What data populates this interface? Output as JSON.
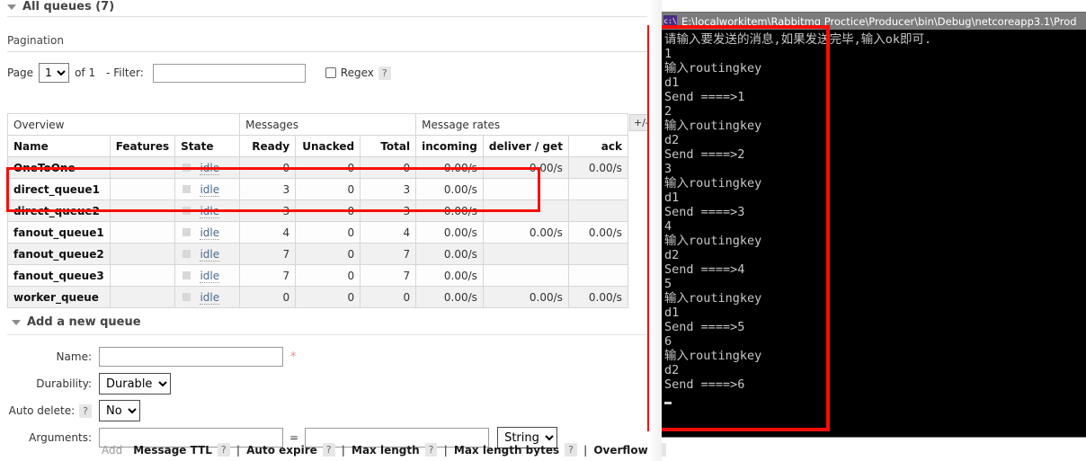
{
  "sections": {
    "all_queues_title": "All queues (7)",
    "pagination_title": "Pagination",
    "add_queue_title": "Add a new queue"
  },
  "pagination": {
    "page_label": "Page",
    "page_value": "1",
    "of_label": "of 1",
    "filter_label": "- Filter:",
    "filter_value": "",
    "regex_label": "Regex",
    "help_mark": "?"
  },
  "table": {
    "group_headers": [
      {
        "label": "Overview",
        "span": 3
      },
      {
        "label": "Messages",
        "span": 3
      },
      {
        "label": "Message rates",
        "span": 3
      }
    ],
    "columns": [
      "Name",
      "Features",
      "State",
      "Ready",
      "Unacked",
      "Total",
      "incoming",
      "deliver / get",
      "ack"
    ],
    "plus_minus": "+/-",
    "state_text": "idle",
    "rows": [
      {
        "name": "OneToOne",
        "features": "",
        "state": "idle",
        "ready": "0",
        "unacked": "0",
        "total": "0",
        "incoming": "0.00/s",
        "deliver": "0.00/s",
        "ack": "0.00/s"
      },
      {
        "name": "direct_queue1",
        "features": "",
        "state": "idle",
        "ready": "3",
        "unacked": "0",
        "total": "3",
        "incoming": "0.00/s",
        "deliver": "",
        "ack": ""
      },
      {
        "name": "direct_queue2",
        "features": "",
        "state": "idle",
        "ready": "3",
        "unacked": "0",
        "total": "3",
        "incoming": "0.00/s",
        "deliver": "",
        "ack": ""
      },
      {
        "name": "fanout_queue1",
        "features": "",
        "state": "idle",
        "ready": "4",
        "unacked": "0",
        "total": "4",
        "incoming": "0.00/s",
        "deliver": "0.00/s",
        "ack": "0.00/s"
      },
      {
        "name": "fanout_queue2",
        "features": "",
        "state": "idle",
        "ready": "7",
        "unacked": "0",
        "total": "7",
        "incoming": "0.00/s",
        "deliver": "",
        "ack": ""
      },
      {
        "name": "fanout_queue3",
        "features": "",
        "state": "idle",
        "ready": "7",
        "unacked": "0",
        "total": "7",
        "incoming": "0.00/s",
        "deliver": "",
        "ack": ""
      },
      {
        "name": "worker_queue",
        "features": "",
        "state": "idle",
        "ready": "0",
        "unacked": "0",
        "total": "0",
        "incoming": "0.00/s",
        "deliver": "0.00/s",
        "ack": "0.00/s"
      }
    ]
  },
  "form": {
    "name_label": "Name:",
    "name_value": "",
    "required_star": "*",
    "durability_label": "Durability:",
    "durability_value": "Durable",
    "auto_delete_label": "Auto delete:",
    "auto_delete_value": "No",
    "auto_delete_help": "?",
    "arguments_label": "Arguments:",
    "arg_key_value": "",
    "arg_eq": "=",
    "arg_val_value": "",
    "arg_type_value": "String",
    "add_link": "Add",
    "presets": [
      {
        "label": "Message TTL",
        "help": "?"
      },
      {
        "label": "Auto expire",
        "help": "?"
      },
      {
        "label": "Max length",
        "help": "?"
      },
      {
        "label": "Max length bytes",
        "help": "?"
      },
      {
        "label": "Overflow",
        "help": "?"
      }
    ],
    "preset_sep": "|"
  },
  "console": {
    "icon_text": "c:\\",
    "title": "E:\\localworkitem\\Rabbitmq Proctice\\Producer\\bin\\Debug\\netcoreapp3.1\\Prod",
    "output": "请输入要发送的消息,如果发送完毕,输入ok即可.\n1\n输入routingkey\nd1\nSend ====>1\n2\n输入routingkey\nd2\nSend ====>2\n3\n输入routingkey\nd1\nSend ====>3\n4\n输入routingkey\nd2\nSend ====>4\n5\n输入routingkey\nd1\nSend ====>5\n6\n输入routingkey\nd2\nSend ====>6\n"
  },
  "colors": {
    "highlight": "#fb0d06",
    "console_bg": "#000000",
    "console_fg": "#c8c8c8",
    "title_bar": "#7b7b7b"
  }
}
